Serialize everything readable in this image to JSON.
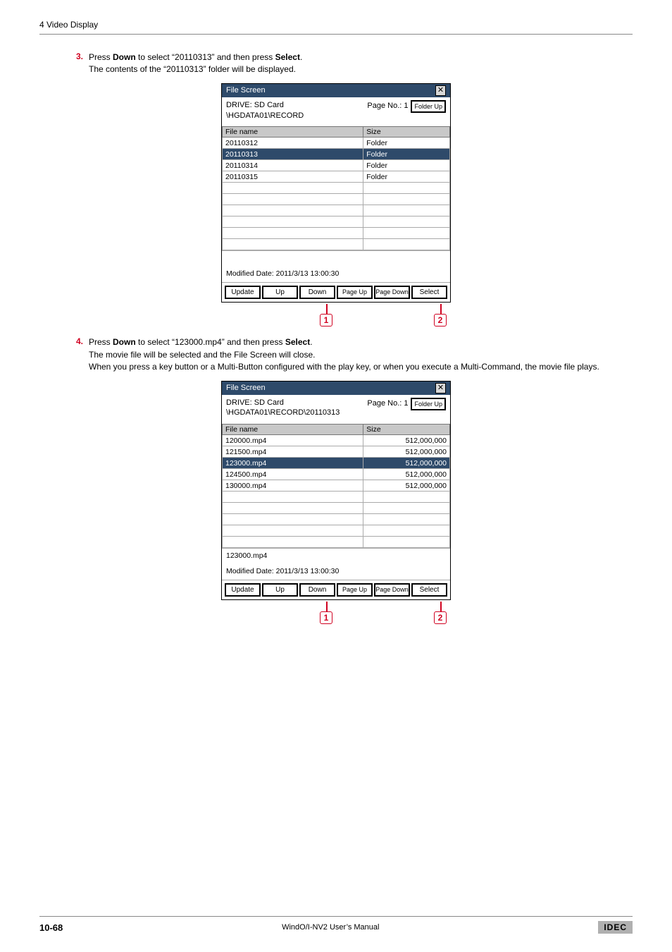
{
  "header": {
    "section": "4 Video Display"
  },
  "steps": {
    "s3": {
      "num": "3.",
      "text_a": "Press ",
      "text_b": "Down",
      "text_c": " to select “20110313” and then press ",
      "text_d": "Select",
      "text_e": ".",
      "sub": "The contents of the “20110313” folder will be displayed."
    },
    "s4": {
      "num": "4.",
      "text_a": "Press ",
      "text_b": "Down",
      "text_c": " to select “123000.mp4” and then press ",
      "text_d": "Select",
      "text_e": ".",
      "sub1": "The movie file will be selected and the File Screen will close.",
      "sub2": "When you press a key button or a Multi-Button configured with the play key, or when you execute a Multi-Command, the movie file plays."
    }
  },
  "fs_common": {
    "title": "File Screen",
    "close": "✕",
    "drive_label": "DRIVE: SD Card",
    "page_no": "Page No.: 1",
    "folder_up": "Folder Up",
    "col_name": "File name",
    "col_size": "Size",
    "modified": "Modified Date: 2011/3/13 13:00:30",
    "buttons": {
      "update": "Update",
      "up": "Up",
      "down": "Down",
      "page_up": "Page Up",
      "page_down": "Page Down",
      "select": "Select"
    },
    "callout1": "1",
    "callout2": "2"
  },
  "fs1": {
    "path": "\\HGDATA01\\RECORD",
    "rows": [
      {
        "name": "20110312",
        "size": "Folder",
        "selected": false
      },
      {
        "name": "20110313",
        "size": "Folder",
        "selected": true
      },
      {
        "name": "20110314",
        "size": "Folder",
        "selected": false
      },
      {
        "name": "20110315",
        "size": "Folder",
        "selected": false
      }
    ],
    "blank_rows": 6,
    "selected_file": ""
  },
  "fs2": {
    "path": "\\HGDATA01\\RECORD\\20110313",
    "rows": [
      {
        "name": "120000.mp4",
        "size": "512,000,000",
        "selected": false,
        "num": true
      },
      {
        "name": "121500.mp4",
        "size": "512,000,000",
        "selected": false,
        "num": true
      },
      {
        "name": "123000.mp4",
        "size": "512,000,000",
        "selected": true,
        "num": true
      },
      {
        "name": "124500.mp4",
        "size": "512,000,000",
        "selected": false,
        "num": true
      },
      {
        "name": "130000.mp4",
        "size": "512,000,000",
        "selected": false,
        "num": true
      }
    ],
    "blank_rows": 5,
    "selected_file": "123000.mp4"
  },
  "footer": {
    "page": "10-68",
    "title": "WindO/I-NV2 User’s Manual",
    "brand": "IDEC"
  }
}
